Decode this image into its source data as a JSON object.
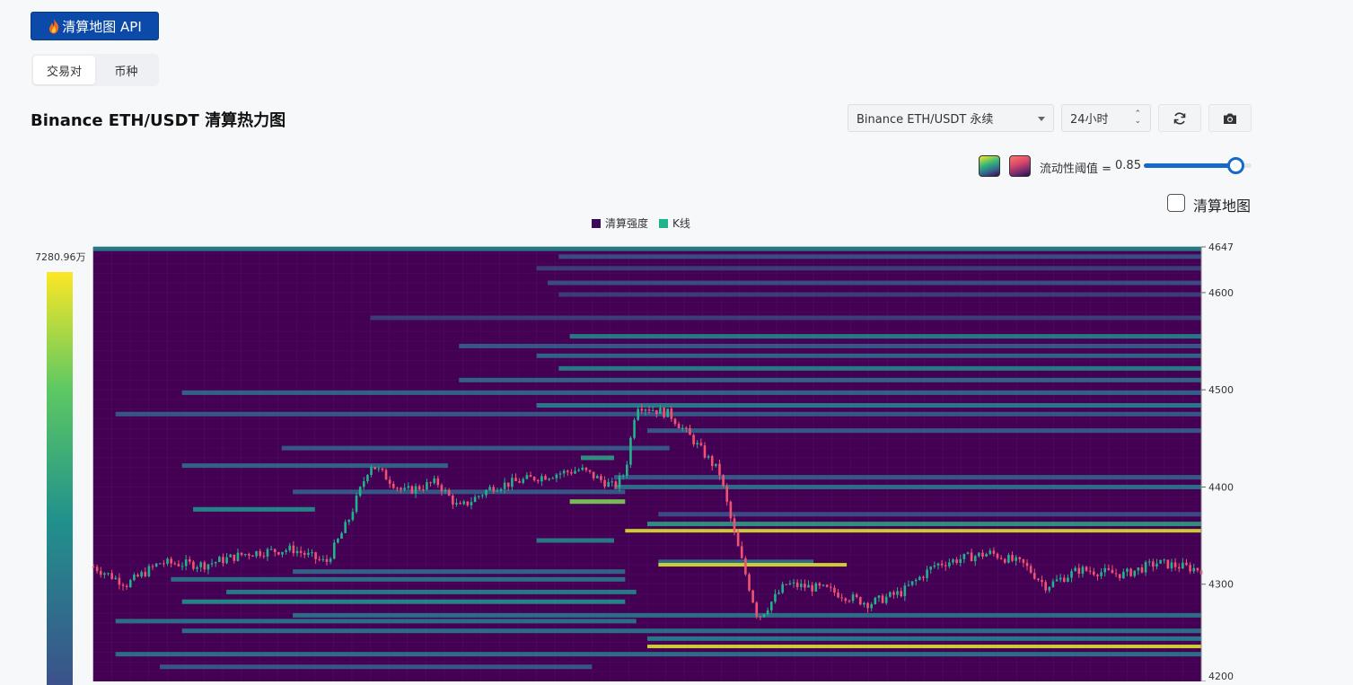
{
  "header": {
    "api_button_label": "清算地图 API",
    "tabs": [
      {
        "label": "交易对",
        "active": true
      },
      {
        "label": "币种",
        "active": false
      }
    ]
  },
  "title": "Binance ETH/USDT 清算热力图",
  "controls": {
    "pair_select_value": "Binance ETH/USDT 永续",
    "range_select_value": "24小时",
    "refresh_icon": "refresh-icon",
    "camera_icon": "camera-icon",
    "palette_icons": [
      "palette-viridis-icon",
      "palette-magma-icon"
    ],
    "threshold_label": "流动性阈值 =",
    "threshold_value": "0.85",
    "threshold_fraction": 0.85,
    "liquidation_map_label": "清算地图",
    "liquidation_map_checked": false
  },
  "colors": {
    "accent": "#0b4aa8",
    "slider": "#1769c7",
    "heat_bg": "#440154",
    "up": "#22b38c",
    "down": "#ef5370",
    "hot": "#fde725"
  },
  "chart_data": {
    "type": "heatmap",
    "title": "Binance ETH/USDT 清算热力图",
    "legend": [
      {
        "name": "清算强度",
        "color": "#3b0a57"
      },
      {
        "name": "K线",
        "color": "#22b38c"
      }
    ],
    "legend_position": "top-center",
    "colorbar": {
      "max_label": "7280.96万",
      "max": 72809600,
      "min": 0
    },
    "y_axis": {
      "ticks": [
        4647,
        4600,
        4500,
        4400,
        4300,
        4200
      ],
      "range": [
        4200,
        4647
      ],
      "position": "right"
    },
    "x_range": [
      0,
      1
    ],
    "candles_anchor_close": [
      [
        0.0,
        4318
      ],
      [
        0.03,
        4300
      ],
      [
        0.06,
        4322
      ],
      [
        0.1,
        4320
      ],
      [
        0.14,
        4332
      ],
      [
        0.18,
        4336
      ],
      [
        0.21,
        4322
      ],
      [
        0.23,
        4365
      ],
      [
        0.25,
        4424
      ],
      [
        0.28,
        4395
      ],
      [
        0.31,
        4405
      ],
      [
        0.33,
        4378
      ],
      [
        0.36,
        4400
      ],
      [
        0.4,
        4410
      ],
      [
        0.44,
        4418
      ],
      [
        0.48,
        4415
      ],
      [
        0.49,
        4485
      ],
      [
        0.52,
        4475
      ],
      [
        0.54,
        4450
      ],
      [
        0.565,
        4415
      ],
      [
        0.47,
        4400
      ],
      [
        0.58,
        4345
      ],
      [
        0.6,
        4265
      ],
      [
        0.625,
        4300
      ],
      [
        0.66,
        4295
      ],
      [
        0.7,
        4280
      ],
      [
        0.73,
        4292
      ],
      [
        0.76,
        4320
      ],
      [
        0.79,
        4328
      ],
      [
        0.81,
        4332
      ],
      [
        0.84,
        4320
      ],
      [
        0.86,
        4298
      ],
      [
        0.89,
        4315
      ],
      [
        0.93,
        4310
      ],
      [
        0.96,
        4322
      ],
      [
        1.0,
        4315
      ]
    ],
    "liquidation_bands": [
      {
        "price": 4645,
        "x_start": 0.0,
        "x_end": 1.0,
        "intensity": 0.45
      },
      {
        "price": 4637,
        "x_start": 0.42,
        "x_end": 1.0,
        "intensity": 0.25
      },
      {
        "price": 4625,
        "x_start": 0.4,
        "x_end": 1.0,
        "intensity": 0.2
      },
      {
        "price": 4610,
        "x_start": 0.41,
        "x_end": 1.0,
        "intensity": 0.25
      },
      {
        "price": 4598,
        "x_start": 0.42,
        "x_end": 1.0,
        "intensity": 0.2
      },
      {
        "price": 4574,
        "x_start": 0.25,
        "x_end": 1.0,
        "intensity": 0.2
      },
      {
        "price": 4555,
        "x_start": 0.43,
        "x_end": 1.0,
        "intensity": 0.45
      },
      {
        "price": 4545,
        "x_start": 0.33,
        "x_end": 1.0,
        "intensity": 0.3
      },
      {
        "price": 4535,
        "x_start": 0.4,
        "x_end": 1.0,
        "intensity": 0.35
      },
      {
        "price": 4522,
        "x_start": 0.42,
        "x_end": 1.0,
        "intensity": 0.45
      },
      {
        "price": 4510,
        "x_start": 0.33,
        "x_end": 1.0,
        "intensity": 0.35
      },
      {
        "price": 4497,
        "x_start": 0.08,
        "x_end": 1.0,
        "intensity": 0.35
      },
      {
        "price": 4484,
        "x_start": 0.4,
        "x_end": 1.0,
        "intensity": 0.45
      },
      {
        "price": 4475,
        "x_start": 0.02,
        "x_end": 1.0,
        "intensity": 0.3
      },
      {
        "price": 4458,
        "x_start": 0.5,
        "x_end": 1.0,
        "intensity": 0.3
      },
      {
        "price": 4440,
        "x_start": 0.17,
        "x_end": 0.52,
        "intensity": 0.3
      },
      {
        "price": 4430,
        "x_start": 0.44,
        "x_end": 0.47,
        "intensity": 0.55
      },
      {
        "price": 4422,
        "x_start": 0.08,
        "x_end": 0.32,
        "intensity": 0.35
      },
      {
        "price": 4410,
        "x_start": 0.47,
        "x_end": 1.0,
        "intensity": 0.3
      },
      {
        "price": 4400,
        "x_start": 0.47,
        "x_end": 1.0,
        "intensity": 0.4
      },
      {
        "price": 4395,
        "x_start": 0.18,
        "x_end": 0.48,
        "intensity": 0.3
      },
      {
        "price": 4385,
        "x_start": 0.43,
        "x_end": 0.48,
        "intensity": 0.8
      },
      {
        "price": 4377,
        "x_start": 0.09,
        "x_end": 0.2,
        "intensity": 0.5
      },
      {
        "price": 4372,
        "x_start": 0.51,
        "x_end": 1.0,
        "intensity": 0.25
      },
      {
        "price": 4362,
        "x_start": 0.5,
        "x_end": 1.0,
        "intensity": 0.55
      },
      {
        "price": 4355,
        "x_start": 0.48,
        "x_end": 1.0,
        "intensity": 0.95
      },
      {
        "price": 4345,
        "x_start": 0.4,
        "x_end": 0.47,
        "intensity": 0.45
      },
      {
        "price": 4323,
        "x_start": 0.51,
        "x_end": 0.65,
        "intensity": 0.4
      },
      {
        "price": 4320,
        "x_start": 0.51,
        "x_end": 0.68,
        "intensity": 0.95
      },
      {
        "price": 4313,
        "x_start": 0.18,
        "x_end": 0.48,
        "intensity": 0.35
      },
      {
        "price": 4305,
        "x_start": 0.07,
        "x_end": 0.48,
        "intensity": 0.4
      },
      {
        "price": 4292,
        "x_start": 0.12,
        "x_end": 0.49,
        "intensity": 0.45
      },
      {
        "price": 4282,
        "x_start": 0.08,
        "x_end": 0.48,
        "intensity": 0.5
      },
      {
        "price": 4268,
        "x_start": 0.18,
        "x_end": 1.0,
        "intensity": 0.4
      },
      {
        "price": 4262,
        "x_start": 0.02,
        "x_end": 0.49,
        "intensity": 0.4
      },
      {
        "price": 4252,
        "x_start": 0.08,
        "x_end": 1.0,
        "intensity": 0.4
      },
      {
        "price": 4244,
        "x_start": 0.5,
        "x_end": 1.0,
        "intensity": 0.45
      },
      {
        "price": 4236,
        "x_start": 0.5,
        "x_end": 1.0,
        "intensity": 0.95
      },
      {
        "price": 4228,
        "x_start": 0.02,
        "x_end": 1.0,
        "intensity": 0.4
      },
      {
        "price": 4215,
        "x_start": 0.06,
        "x_end": 0.45,
        "intensity": 0.3
      }
    ]
  }
}
